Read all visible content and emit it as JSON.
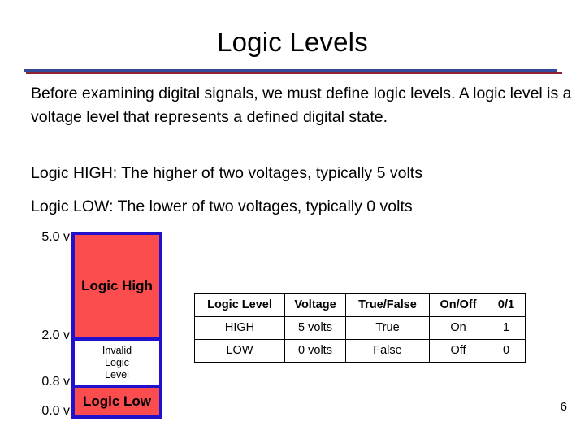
{
  "slide": {
    "title": "Logic Levels",
    "page_number": "6",
    "accent_blue": "#334A99",
    "accent_red": "#8E2230"
  },
  "body": {
    "paragraph": "Before examining digital signals, we must define logic levels. A logic level is a voltage level that represents a defined digital state.",
    "logic_high_line": "Logic HIGH: The higher of two voltages, typically 5 volts",
    "logic_low_line": "Logic LOW: The lower of two voltages, typically 0 volts"
  },
  "voltage_diagram": {
    "border_color": "#2211CC",
    "fill_color": "#FB4D4D",
    "labels": {
      "v5": "5.0 v",
      "v2": "2.0 v",
      "v08": "0.8 v",
      "v00": "0.0 v"
    },
    "bands": {
      "high": "Logic High",
      "invalid_line1": "Invalid",
      "invalid_line2": "Logic",
      "invalid_line3": "Level",
      "low": "Logic Low"
    }
  },
  "table": {
    "headers": [
      "Logic Level",
      "Voltage",
      "True/False",
      "On/Off",
      "0/1"
    ],
    "rows": [
      [
        "HIGH",
        "5 volts",
        "True",
        "On",
        "1"
      ],
      [
        "LOW",
        "0 volts",
        "False",
        "Off",
        "0"
      ]
    ]
  }
}
